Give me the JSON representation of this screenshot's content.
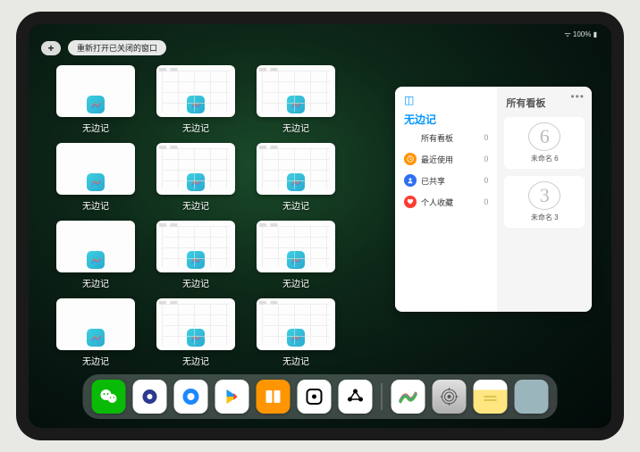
{
  "status": {
    "battery": "100%"
  },
  "topbar": {
    "reopen_label": "重新打开已关闭的窗口"
  },
  "app": {
    "label": "无边记"
  },
  "panel": {
    "title": "无边记",
    "right_title": "所有看板",
    "items": [
      {
        "label": "所有看板",
        "count": "0",
        "color": "#1fbfd6"
      },
      {
        "label": "最近使用",
        "count": "0",
        "color": "#ff9500"
      },
      {
        "label": "已共享",
        "count": "0",
        "color": "#2d6ff5"
      },
      {
        "label": "个人收藏",
        "count": "0",
        "color": "#ff3b30"
      }
    ],
    "boards": [
      {
        "drawing": "6",
        "label": "未命名 6",
        "sub": ""
      },
      {
        "drawing": "3",
        "label": "未命名 3",
        "sub": ""
      }
    ]
  },
  "dock": {
    "apps": [
      {
        "name": "wechat",
        "bg": "#09bb07"
      },
      {
        "name": "quark",
        "bg": "#ffffff"
      },
      {
        "name": "qqbrowser",
        "bg": "#1e88ff"
      },
      {
        "name": "play",
        "bg": "#ffffff"
      },
      {
        "name": "books",
        "bg": "#ff9500"
      },
      {
        "name": "dice",
        "bg": "#ffffff"
      },
      {
        "name": "hex",
        "bg": "#ffffff"
      },
      {
        "name": "freeform",
        "bg": "#ffffff"
      },
      {
        "name": "settings",
        "bg": "#d0d0d0"
      },
      {
        "name": "notes",
        "bg": "#fff4a3"
      },
      {
        "name": "appfolder",
        "bg": "#9ec9d6"
      }
    ]
  }
}
